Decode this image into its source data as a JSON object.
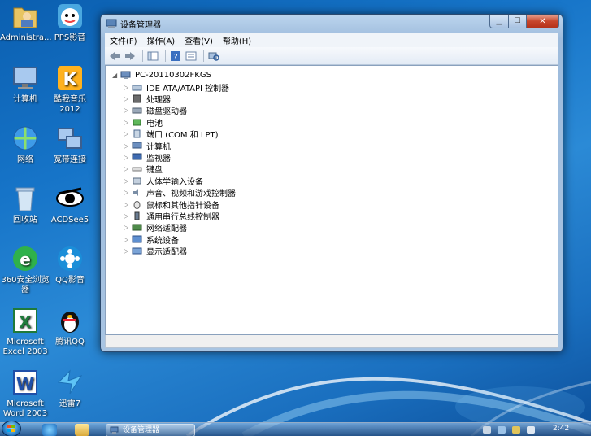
{
  "desktop": {
    "icons": [
      {
        "label": "Administra...",
        "icon": "user-folder-icon"
      },
      {
        "label": "PPS影音",
        "icon": "pps-player-icon"
      },
      {
        "label": "计算机",
        "icon": "computer-icon"
      },
      {
        "label": "酷我音乐 2012",
        "icon": "kuwo-music-icon"
      },
      {
        "label": "网络",
        "icon": "network-icon"
      },
      {
        "label": "宽带连接",
        "icon": "broadband-connection-icon"
      },
      {
        "label": "回收站",
        "icon": "recycle-bin-icon"
      },
      {
        "label": "ACDSee5",
        "icon": "acdsee-icon"
      },
      {
        "label": "360安全浏览器",
        "icon": "360-browser-icon"
      },
      {
        "label": "QQ影音",
        "icon": "qq-player-icon"
      },
      {
        "label": "Microsoft Excel 2003",
        "icon": "excel-icon"
      },
      {
        "label": "腾讯QQ",
        "icon": "qq-penguin-icon"
      },
      {
        "label": "Microsoft Word 2003",
        "icon": "word-icon"
      },
      {
        "label": "迅雷7",
        "icon": "xunlei-icon"
      }
    ]
  },
  "window": {
    "title": "设备管理器",
    "menu": [
      "文件(F)",
      "操作(A)",
      "查看(V)",
      "帮助(H)"
    ],
    "tree": {
      "root": "PC-20110302FKGS",
      "nodes": [
        {
          "label": "IDE ATA/ATAPI 控制器",
          "icon": "ide-controller-icon"
        },
        {
          "label": "处理器",
          "icon": "processor-icon"
        },
        {
          "label": "磁盘驱动器",
          "icon": "disk-drive-icon"
        },
        {
          "label": "电池",
          "icon": "battery-icon"
        },
        {
          "label": "端口 (COM 和 LPT)",
          "icon": "port-icon"
        },
        {
          "label": "计算机",
          "icon": "computer-icon"
        },
        {
          "label": "监视器",
          "icon": "monitor-icon"
        },
        {
          "label": "键盘",
          "icon": "keyboard-icon"
        },
        {
          "label": "人体学输入设备",
          "icon": "hid-icon"
        },
        {
          "label": "声音、视频和游戏控制器",
          "icon": "sound-icon"
        },
        {
          "label": "鼠标和其他指针设备",
          "icon": "mouse-icon"
        },
        {
          "label": "通用串行总线控制器",
          "icon": "usb-icon"
        },
        {
          "label": "网络适配器",
          "icon": "network-adapter-icon"
        },
        {
          "label": "系统设备",
          "icon": "system-device-icon"
        },
        {
          "label": "显示适配器",
          "icon": "display-adapter-icon"
        }
      ]
    }
  },
  "taskbar": {
    "task_label": "设备管理器",
    "clock": "2:42"
  },
  "colors": {
    "desktop": "#1674c8",
    "close_button": "#c7462c",
    "window_frame": "#a8c4e2"
  }
}
